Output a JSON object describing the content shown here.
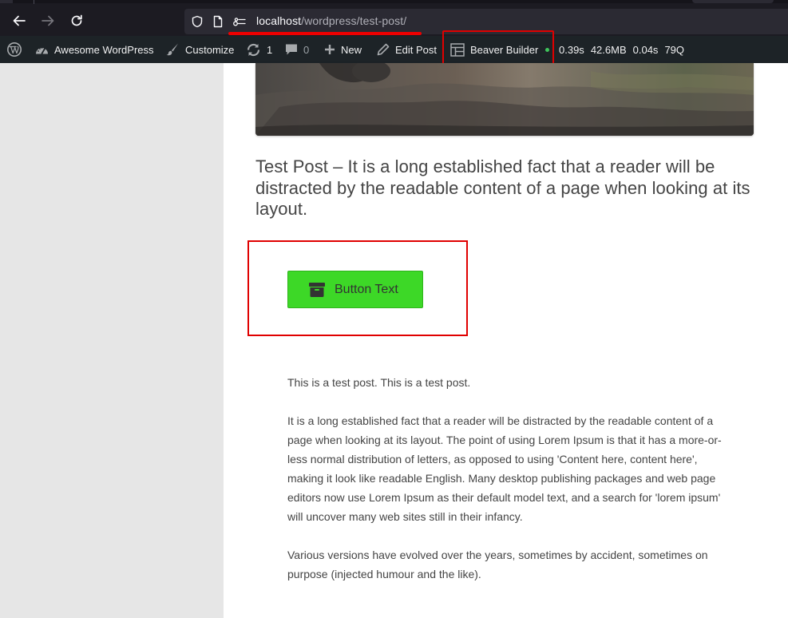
{
  "browser": {
    "url_host": "localhost",
    "url_path": "/wordpress/test-post/"
  },
  "adminbar": {
    "site_name": "Awesome WordPress",
    "customize": "Customize",
    "updates_count": "1",
    "comments_count": "0",
    "new": "New",
    "edit_post": "Edit Post",
    "beaver_builder": "Beaver Builder",
    "query_monitor": {
      "time": "0.39s",
      "memory": "42.6MB",
      "db_time": "0.04s",
      "queries": "79Q"
    }
  },
  "post": {
    "title": "Test Post – It is a long established fact that a reader will be distracted by the readable content of a page when looking at its layout.",
    "button_text": "Button Text",
    "paragraphs": [
      "This is a test post. This is a test post.",
      "It is a long established fact that a reader will be distracted by the readable content of a page when looking at its layout. The point of using Lorem Ipsum is that it has a more-or-less normal distribution of letters, as opposed to using 'Content here, con­tent here', making it look like readable English. Many desktop publishing packages and web page editors now use Lorem Ipsum as their default model text, and a search for 'lorem ipsum' will uncover many web sites still in their infancy.",
      "Various versions have evolved over the years, sometimes by accident, sometimes on purpose (injected humour and the like)."
    ]
  },
  "colors": {
    "admin_bar": "#1d2327",
    "button_green": "#3dd827",
    "annotation_red": "#e00000"
  },
  "icons": {
    "back": "arrow-left-icon",
    "forward": "arrow-right-icon",
    "reload": "reload-icon",
    "shield": "shield-icon",
    "page": "page-icon",
    "permissions": "permissions-icon",
    "wp_logo": "wordpress-logo-icon",
    "dashboard": "dashboard-icon",
    "brush": "brush-icon",
    "updates": "updates-icon",
    "comments": "comment-icon",
    "plus": "plus-icon",
    "pencil": "pencil-icon",
    "beaver": "beaver-builder-icon",
    "archive": "archive-icon"
  }
}
